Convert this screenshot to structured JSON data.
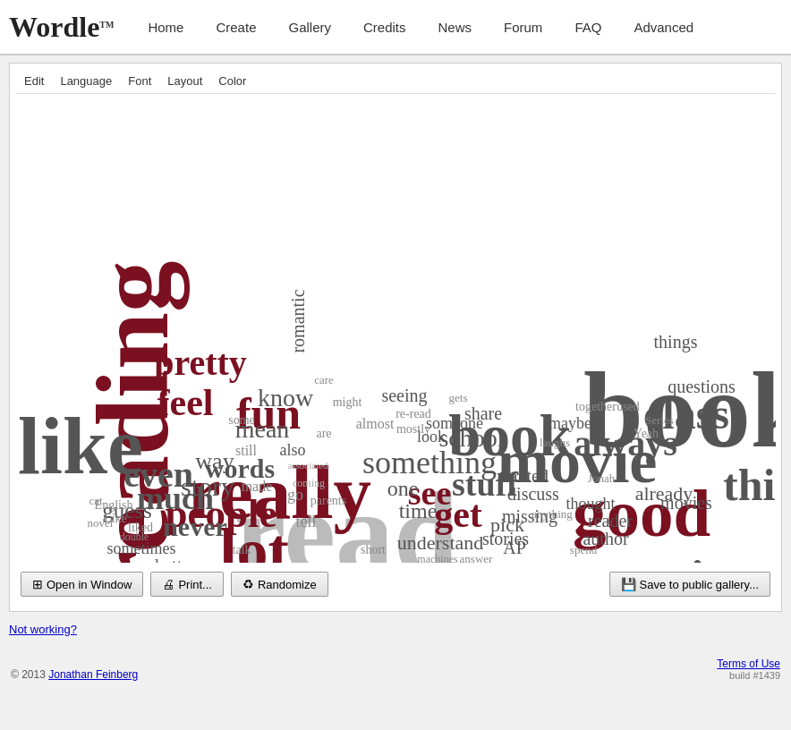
{
  "logo": {
    "text": "Wordle",
    "tm": "TM"
  },
  "nav": {
    "items": [
      {
        "label": "Home",
        "id": "home"
      },
      {
        "label": "Create",
        "id": "create"
      },
      {
        "label": "Gallery",
        "id": "gallery"
      },
      {
        "label": "Credits",
        "id": "credits"
      },
      {
        "label": "News",
        "id": "news"
      },
      {
        "label": "Forum",
        "id": "forum"
      },
      {
        "label": "FAQ",
        "id": "faq"
      },
      {
        "label": "Advanced",
        "id": "advanced"
      }
    ]
  },
  "toolbar": {
    "items": [
      {
        "label": "Edit",
        "id": "edit"
      },
      {
        "label": "Language",
        "id": "language"
      },
      {
        "label": "Font",
        "id": "font"
      },
      {
        "label": "Layout",
        "id": "layout"
      },
      {
        "label": "Color",
        "id": "color"
      }
    ]
  },
  "buttons": {
    "open_window": "Open in Window",
    "print": "Print...",
    "randomize": "Randomize",
    "save": "Save to public gallery..."
  },
  "not_working": "Not working?",
  "footer": {
    "copyright": "© 2013",
    "author": "Jonathan Feinberg",
    "terms": "Terms of Use",
    "build": "build #1439"
  }
}
